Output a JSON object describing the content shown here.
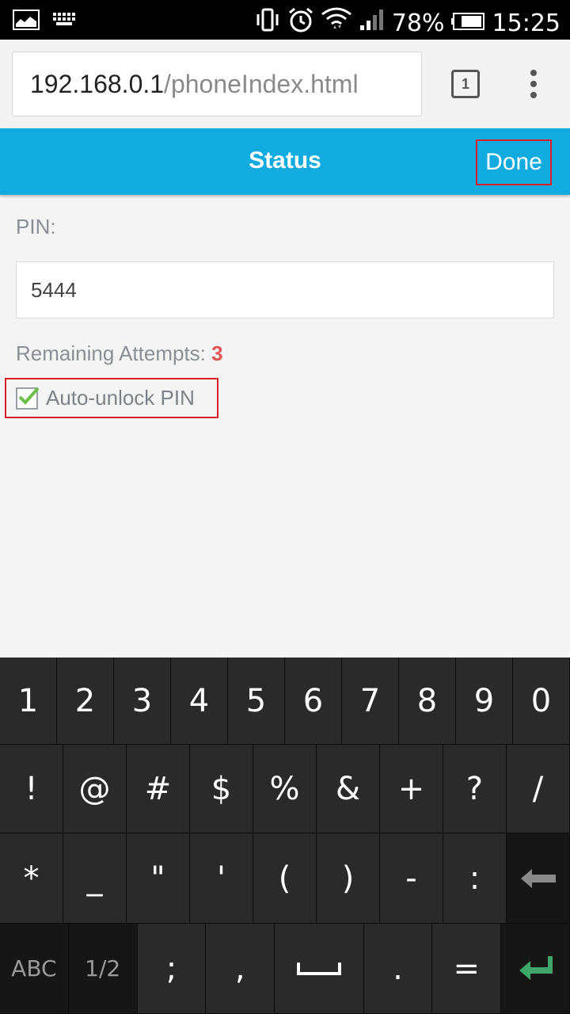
{
  "status_bar": {
    "battery_percent": "78%",
    "time": "15:25",
    "icons": [
      "screenshot-icon",
      "keyboard-icon",
      "vibrate-icon",
      "alarm-icon",
      "wifi-icon",
      "signal-icon",
      "battery-icon"
    ]
  },
  "browser": {
    "url_host": "192.168.0.1",
    "url_path": "/phoneIndex.html",
    "tab_count": "1"
  },
  "header": {
    "title": "Status",
    "done_label": "Done",
    "bar_color": "#11abe0"
  },
  "form": {
    "pin_label": "PIN:",
    "pin_value": "5444",
    "attempts_label": "Remaining Attempts: ",
    "attempts_count": "3",
    "auto_unlock_label": "Auto-unlock PIN",
    "auto_unlock_checked": true
  },
  "keyboard": {
    "row1": [
      "1",
      "2",
      "3",
      "4",
      "5",
      "6",
      "7",
      "8",
      "9",
      "0"
    ],
    "row2": [
      "!",
      "@",
      "#",
      "$",
      "%",
      "&",
      "+",
      "?",
      "/"
    ],
    "row3": [
      "*",
      "_",
      "\"",
      "'",
      "(",
      ")",
      "-",
      ":"
    ],
    "row4": [
      "ABC",
      "1/2",
      ";",
      ",",
      "",
      ".",
      " ="
    ]
  }
}
